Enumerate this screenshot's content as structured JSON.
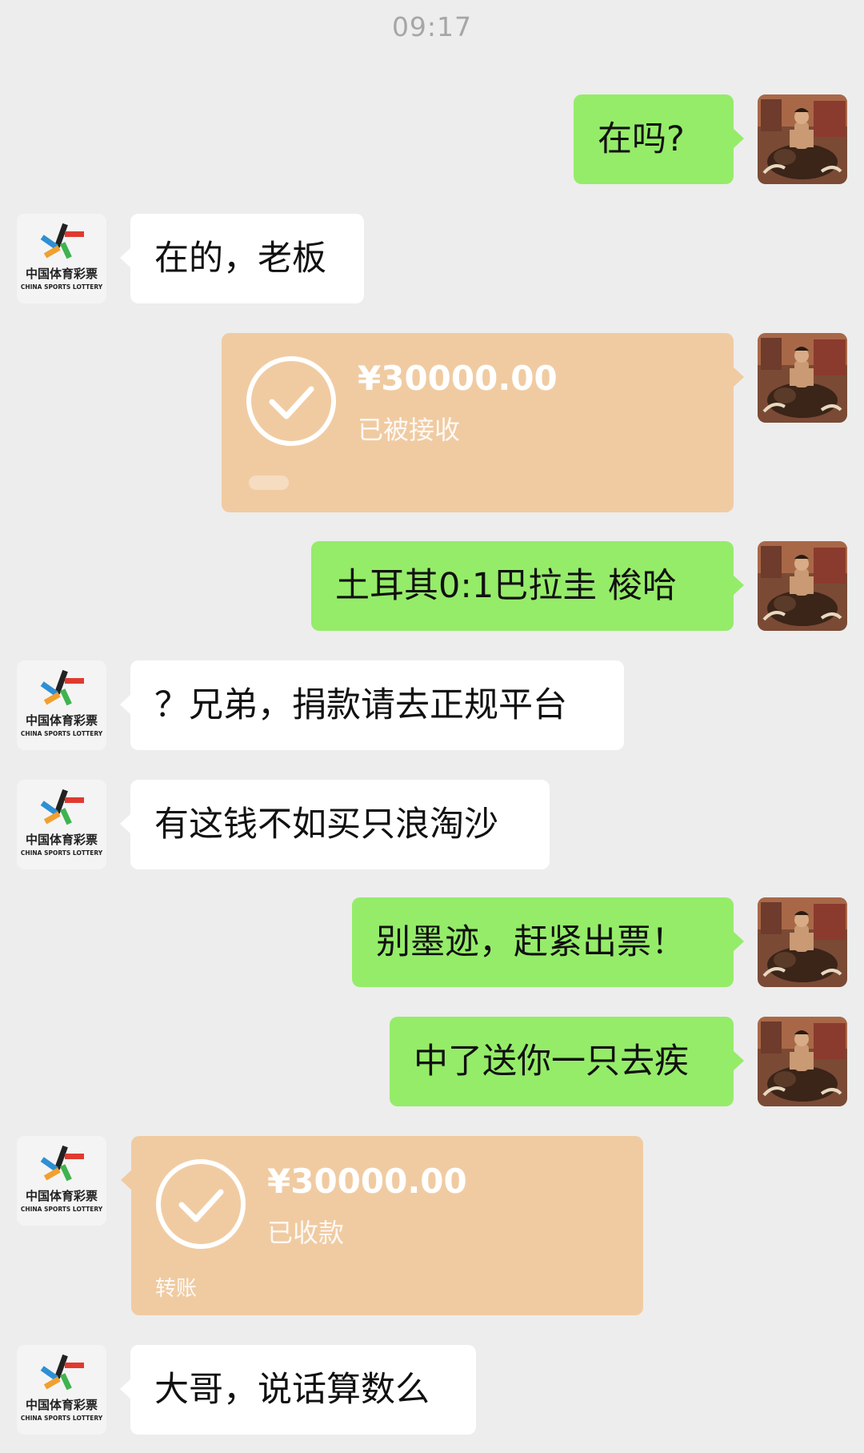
{
  "header": {
    "time": "09:17"
  },
  "messages": [
    {
      "side": "me",
      "type": "text",
      "text": "在吗?"
    },
    {
      "side": "them",
      "type": "text",
      "text": "在的，老板"
    },
    {
      "side": "me",
      "type": "transfer",
      "amount": "¥30000.00",
      "status": "已被接收"
    },
    {
      "side": "me",
      "type": "text",
      "text": "土耳其0:1巴拉圭   梭哈"
    },
    {
      "side": "them",
      "type": "text",
      "text": "？兄弟，捐款请去正规平台"
    },
    {
      "side": "them",
      "type": "text",
      "text": "有这钱不如买只浪淘沙"
    },
    {
      "side": "me",
      "type": "text",
      "text": "别墨迹，赶紧出票！"
    },
    {
      "side": "me",
      "type": "text",
      "text": "中了送你一只去疾"
    },
    {
      "side": "them",
      "type": "transfer",
      "amount": "¥30000.00",
      "status": "已收款",
      "label": "转账"
    },
    {
      "side": "them",
      "type": "text",
      "text": "大哥，说话算数么"
    }
  ],
  "contact": {
    "logo_name": "中国体育彩票",
    "logo_subtitle": "CHINA SPORTS LOTTERY",
    "icon": "china-sports-lottery-logo"
  },
  "me": {
    "icon": "user-avatar-warrior-on-bull"
  },
  "colors": {
    "background": "#ededed",
    "my_bubble": "#95ec69",
    "their_bubble": "#ffffff",
    "transfer": "#f0cba2",
    "time": "#a6a6a6"
  }
}
